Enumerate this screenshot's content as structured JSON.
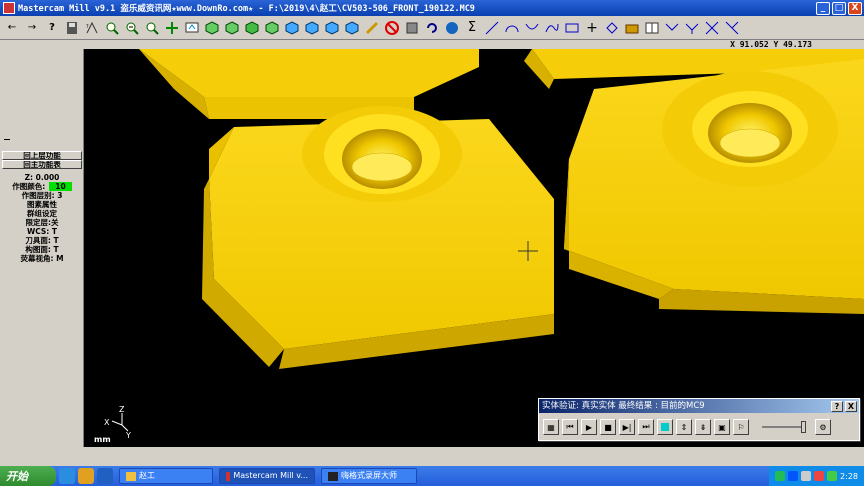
{
  "window": {
    "title": "Mastercam Mill v9.1 盗乐威资讯网★www.DownRo.com★ - F:\\2019\\4\\赵工\\CV503-506_FRONT_190122.MC9",
    "min": "_",
    "max": "□",
    "close": "X"
  },
  "toolbar": {
    "icons": [
      "back-arrow",
      "forward-arrow",
      "help",
      "save",
      "analyze",
      "zoom-window",
      "zoom-out",
      "zoom-fit",
      "pan",
      "screen-regen",
      "view-top",
      "view-front",
      "view-side",
      "view-iso",
      "view-dynamic",
      "view-cube",
      "view-cube-2",
      "view-cube-3",
      "eraser",
      "delete",
      "undo",
      "shade",
      "sigma",
      "line",
      "arc",
      "curve",
      "spline",
      "rectangle",
      "plus",
      "chamfer",
      "solid",
      "window-split",
      "trim",
      "trim-2",
      "trim-3",
      "trim-4"
    ]
  },
  "coords": {
    "text": "X 91.052  Y 49.173"
  },
  "leftpanel": {
    "items": [
      "回上层功能",
      "回主功能表",
      "Z:  0.000",
      "作图颜色:",
      "作图层别: 3",
      "图素属性",
      "群组设定",
      "限定层:关",
      "WCS:  T",
      "刀具面: T",
      "构图面: T",
      "荧幕视角: M"
    ],
    "color_value": "10"
  },
  "viewport": {
    "axis_z": "Z",
    "axis_x": "X",
    "axis_y": "Y",
    "units": "mm",
    "colors": {
      "part": "#f2cc0a",
      "part_dark": "#b89400",
      "part_light": "#ffe24a",
      "background": "#000000"
    }
  },
  "verify": {
    "title": "实体验证: 真实实体 最终结果 : 目前的MC9",
    "help": "?",
    "close": "X"
  },
  "taskbar": {
    "start": "开始",
    "tasks": [
      "赵工",
      "Mastercam Mill v...",
      "嗨格式录屏大师"
    ],
    "time": "2:28"
  }
}
